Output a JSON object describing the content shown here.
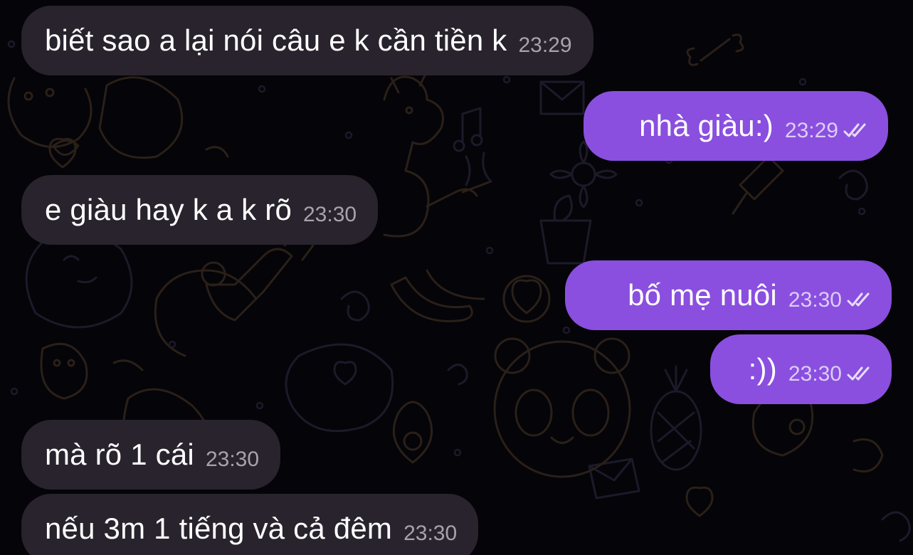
{
  "messages": [
    {
      "text": "biết sao a lại nói câu e k cần tiền k",
      "time": "23:29"
    },
    {
      "text": "nhà giàu:)",
      "time": "23:29"
    },
    {
      "text": "e giàu hay k a k rõ",
      "time": "23:30"
    },
    {
      "text": "bố mẹ nuôi",
      "time": "23:30"
    },
    {
      "text": ":))",
      "time": "23:30"
    },
    {
      "text": "mà rõ 1 cái",
      "time": "23:30"
    },
    {
      "text": "nếu 3m 1 tiếng và cả đêm",
      "time": "23:30"
    }
  ],
  "colors": {
    "background": "#050408",
    "incoming_bubble": "#28232c",
    "outgoing_bubble": "#8a4fdf",
    "text": "#ffffff"
  },
  "icons": {
    "read_receipt": "double-check-icon",
    "wallpaper": "doodle-pattern"
  }
}
